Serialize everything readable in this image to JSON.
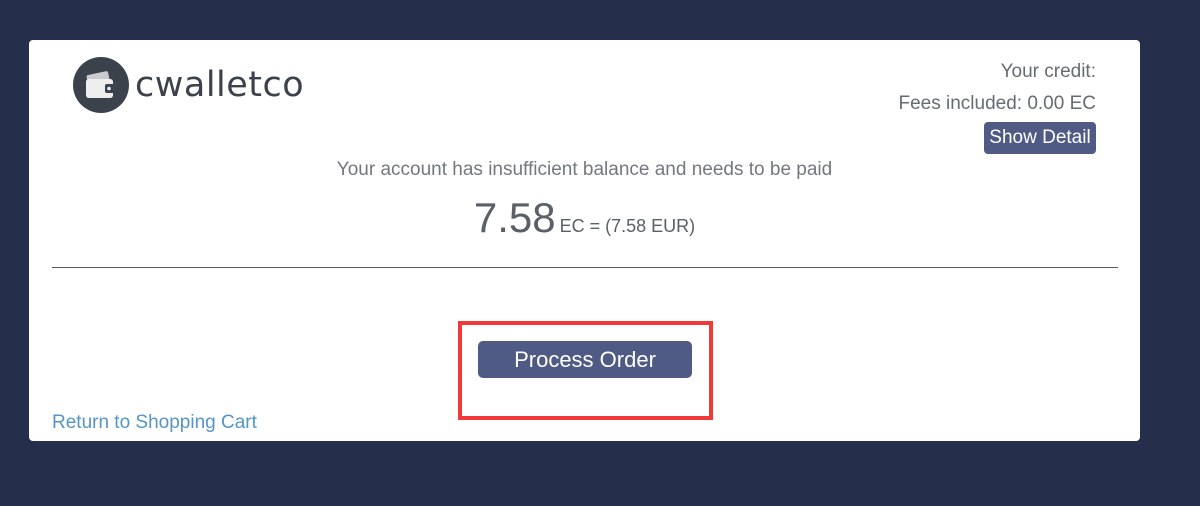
{
  "brand": {
    "name": "cwalletco",
    "icon": "wallet-icon"
  },
  "credit": {
    "label": "Your credit:",
    "fees": "Fees included: 0.00 EC",
    "show_detail_label": "Show Detail"
  },
  "payment": {
    "message": "Your account has insufficient balance and needs to be paid",
    "amount": "7.58",
    "amount_unit": "EC = (7.58 EUR)"
  },
  "actions": {
    "process_order_label": "Process Order",
    "return_link_label": "Return to Shopping Cart"
  },
  "colors": {
    "background": "#252e4a",
    "button": "#4f5b85",
    "link": "#5596c6",
    "highlight": "#f03a3a"
  }
}
